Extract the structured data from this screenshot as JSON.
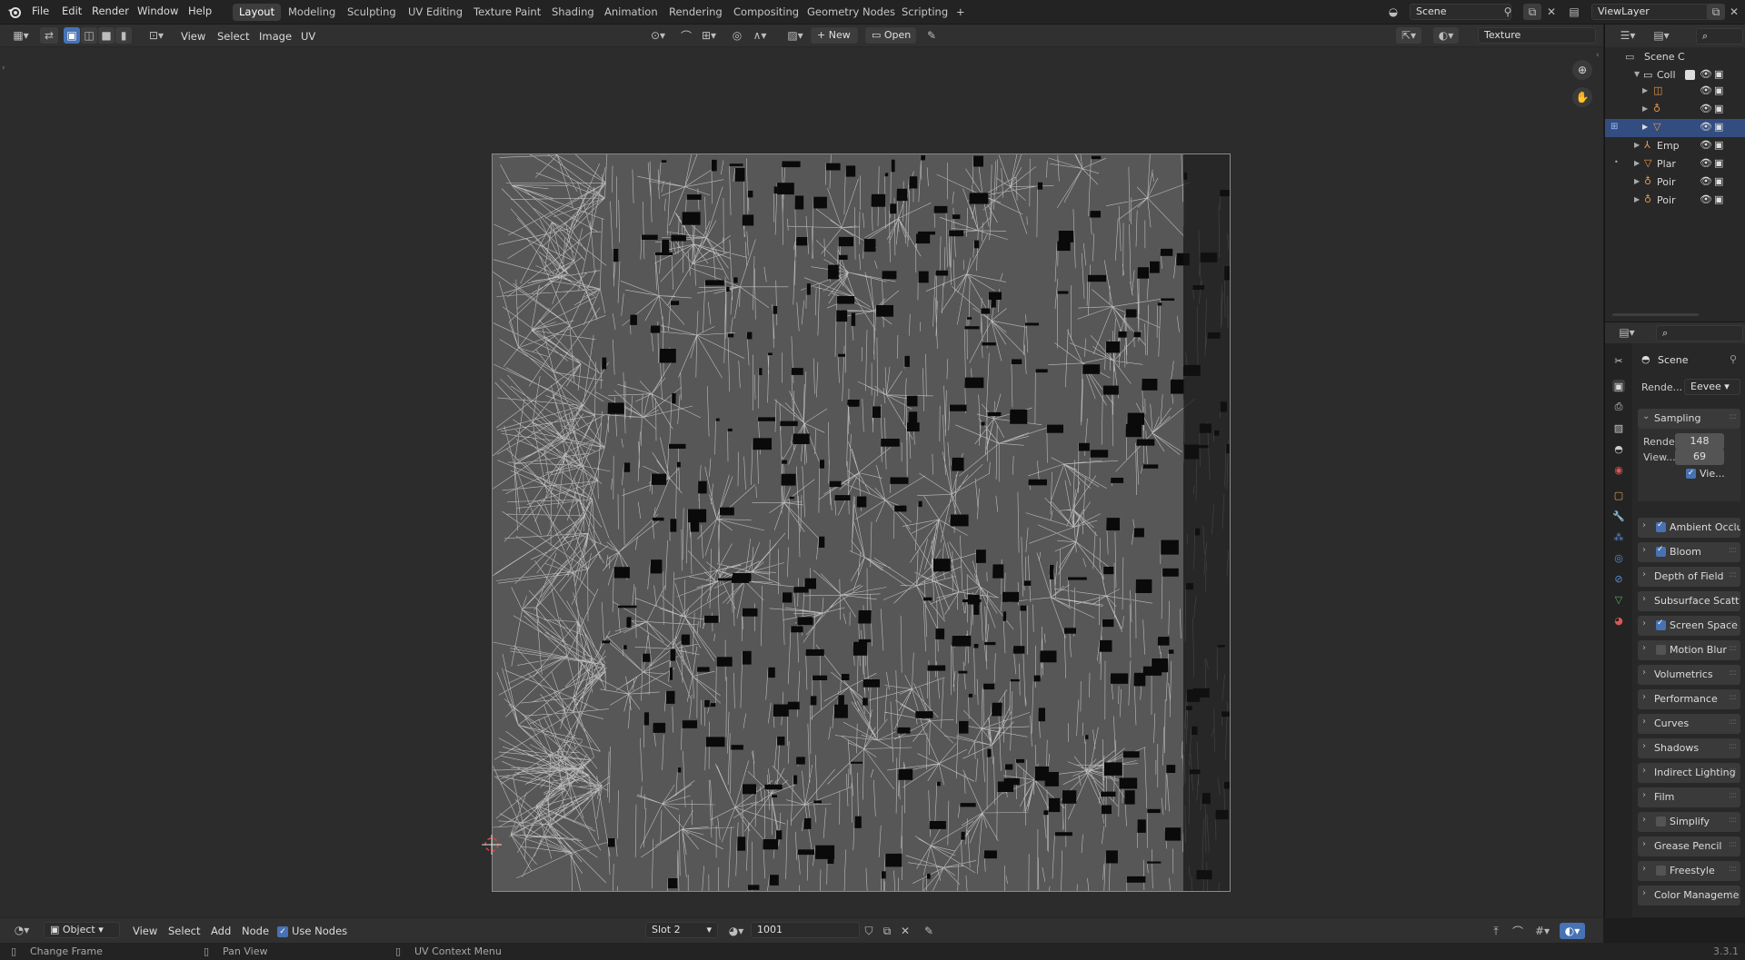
{
  "menu": {
    "file": "File",
    "edit": "Edit",
    "render": "Render",
    "window": "Window",
    "help": "Help"
  },
  "workspaces": [
    "Layout",
    "Modeling",
    "Sculpting",
    "UV Editing",
    "Texture Paint",
    "Shading",
    "Animation",
    "Rendering",
    "Compositing",
    "Geometry Nodes",
    "Scripting"
  ],
  "active_workspace": "Layout",
  "add_workspace": "+",
  "scene_name": "Scene",
  "view_layer": "ViewLayer",
  "image_editor": {
    "menus": {
      "view": "View",
      "select": "Select",
      "image": "Image",
      "uv": "UV"
    },
    "new_label": "New",
    "open_label": "Open",
    "texture_name": "Texture"
  },
  "outliner": {
    "rows": [
      {
        "label": "Scene C"
      },
      {
        "label": "Coll"
      },
      {
        "label": ""
      },
      {
        "label": ""
      },
      {
        "label": ""
      },
      {
        "label": "Emp"
      },
      {
        "label": "Plar"
      },
      {
        "label": "Poir"
      },
      {
        "label": "Poir"
      }
    ]
  },
  "properties": {
    "context": "Scene",
    "render_engine_label": "Rende...",
    "render_engine_value": "Eevee",
    "sampling": {
      "title": "Sampling",
      "render_label": "Rende",
      "render_value": "148",
      "viewport_label": "View...",
      "viewport_value": "69",
      "viewport_denoise": "Vie..."
    },
    "panels": [
      {
        "label": "Ambient Occlu",
        "checkbox": true,
        "checked": true
      },
      {
        "label": "Bloom",
        "checkbox": true,
        "checked": true
      },
      {
        "label": "Depth of Field",
        "checkbox": false,
        "checked": false
      },
      {
        "label": "Subsurface Scatt",
        "checkbox": false,
        "checked": false
      },
      {
        "label": "Screen Space",
        "checkbox": true,
        "checked": true
      },
      {
        "label": "Motion Blur",
        "checkbox": true,
        "checked": false
      },
      {
        "label": "Volumetrics",
        "checkbox": false,
        "checked": false
      },
      {
        "label": "Performance",
        "checkbox": false,
        "checked": false
      },
      {
        "label": "Curves",
        "checkbox": false,
        "checked": false
      },
      {
        "label": "Shadows",
        "checkbox": false,
        "checked": false
      },
      {
        "label": "Indirect Lighting",
        "checkbox": false,
        "checked": false
      },
      {
        "label": "Film",
        "checkbox": false,
        "checked": false
      },
      {
        "label": "Simplify",
        "checkbox": true,
        "checked": false
      },
      {
        "label": "Grease Pencil",
        "checkbox": false,
        "checked": false
      },
      {
        "label": "Freestyle",
        "checkbox": true,
        "checked": false
      },
      {
        "label": "Color Manageme",
        "checkbox": false,
        "checked": false
      }
    ]
  },
  "footer": {
    "mode": "Object",
    "view": "View",
    "select": "Select",
    "add": "Add",
    "node": "Node",
    "use_nodes": "Use Nodes",
    "slot": "Slot 2",
    "tile": "1001"
  },
  "statusbar": {
    "change_frame": "Change Frame",
    "pan_view": "Pan View",
    "uv_context_menu": "UV Context Menu",
    "version": "3.3.1"
  },
  "colors": {
    "accent": "#4772b3",
    "selected_row": "#334d80",
    "background": "#1d1d1d",
    "uv_fill": "#575757"
  }
}
